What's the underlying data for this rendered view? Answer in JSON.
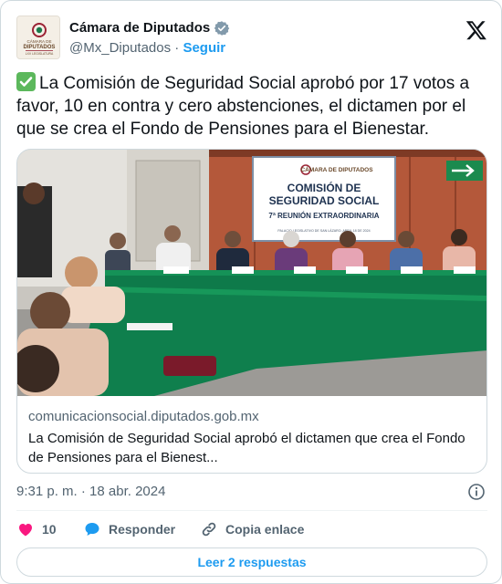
{
  "account": {
    "display_name": "Cámara de Diputados",
    "handle": "@Mx_Diputados",
    "separator": "·",
    "follow_label": "Seguir",
    "logo_line1": "CÁMARA DE",
    "logo_line2": "DIPUTADOS",
    "logo_line3": "LXV LEGISLATURA"
  },
  "tweet": {
    "text": "La Comisión de Seguridad Social aprobó por 17 votos a favor, 10 en contra y cero abstenciones, el dictamen por el que se crea el Fondo de Pensiones para el Bienestar.",
    "leading_emoji": "check-mark-button"
  },
  "link_card": {
    "banner_brand": "CÁMARA DE DIPUTADOS",
    "banner_title_line1": "COMISIÓN DE",
    "banner_title_line2": "SEGURIDAD SOCIAL",
    "banner_subtitle": "7ª REUNIÓN EXTRAORDINARIA",
    "banner_footer": "PALACIO LEGISLATIVO DE SAN LÁZARO, ABRIL 18 DE 2024",
    "domain": "comunicacionsocial.diputados.gob.mx",
    "description": "La Comisión de Seguridad Social aprobó el dictamen que crea el Fondo de Pensiones para el Bienest..."
  },
  "meta": {
    "timestamp": "9:31 p. m. · 18 abr. 2024"
  },
  "actions": {
    "like_count": "10",
    "reply_label": "Responder",
    "copy_label": "Copia enlace"
  },
  "footer": {
    "read_replies_label": "Leer 2 respuestas"
  },
  "colors": {
    "accent": "#1d9bf0",
    "like": "#f91880",
    "muted": "#536471",
    "table_green": "#0e7a4a",
    "wall_wood": "#b4583a"
  }
}
